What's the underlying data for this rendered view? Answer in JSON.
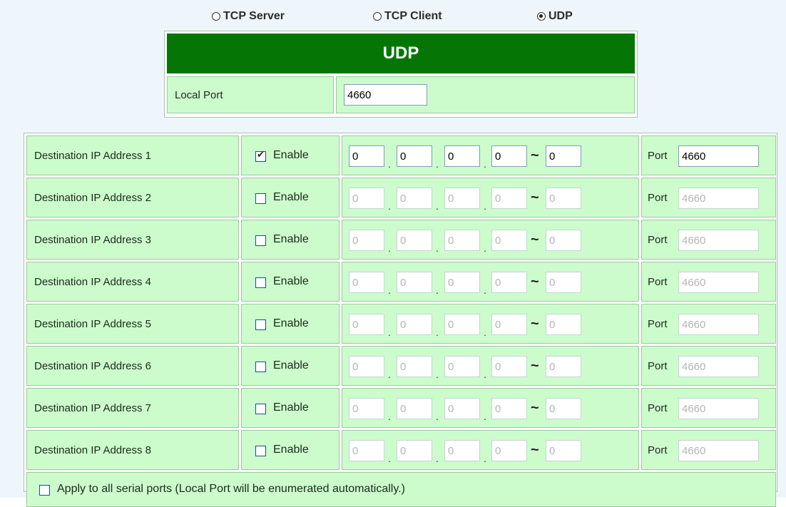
{
  "modes": [
    {
      "label": "TCP Server",
      "selected": false
    },
    {
      "label": "TCP Client",
      "selected": false
    },
    {
      "label": "UDP",
      "selected": true
    }
  ],
  "udp": {
    "title": "UDP",
    "local_port_label": "Local Port",
    "local_port_value": "4660"
  },
  "destinations": [
    {
      "label": "Destination IP Address 1",
      "enabled": true,
      "enable_label": "Enable",
      "ip": [
        "0",
        "0",
        "0",
        "0"
      ],
      "range_end": "0",
      "port_label": "Port",
      "port": "4660"
    },
    {
      "label": "Destination IP Address 2",
      "enabled": false,
      "enable_label": "Enable",
      "ip": [
        "0",
        "0",
        "0",
        "0"
      ],
      "range_end": "0",
      "port_label": "Port",
      "port": "4660"
    },
    {
      "label": "Destination IP Address 3",
      "enabled": false,
      "enable_label": "Enable",
      "ip": [
        "0",
        "0",
        "0",
        "0"
      ],
      "range_end": "0",
      "port_label": "Port",
      "port": "4660"
    },
    {
      "label": "Destination IP Address 4",
      "enabled": false,
      "enable_label": "Enable",
      "ip": [
        "0",
        "0",
        "0",
        "0"
      ],
      "range_end": "0",
      "port_label": "Port",
      "port": "4660"
    },
    {
      "label": "Destination IP Address 5",
      "enabled": false,
      "enable_label": "Enable",
      "ip": [
        "0",
        "0",
        "0",
        "0"
      ],
      "range_end": "0",
      "port_label": "Port",
      "port": "4660"
    },
    {
      "label": "Destination IP Address 6",
      "enabled": false,
      "enable_label": "Enable",
      "ip": [
        "0",
        "0",
        "0",
        "0"
      ],
      "range_end": "0",
      "port_label": "Port",
      "port": "4660"
    },
    {
      "label": "Destination IP Address 7",
      "enabled": false,
      "enable_label": "Enable",
      "ip": [
        "0",
        "0",
        "0",
        "0"
      ],
      "range_end": "0",
      "port_label": "Port",
      "port": "4660"
    },
    {
      "label": "Destination IP Address 8",
      "enabled": false,
      "enable_label": "Enable",
      "ip": [
        "0",
        "0",
        "0",
        "0"
      ],
      "range_end": "0",
      "port_label": "Port",
      "port": "4660"
    }
  ],
  "ip_separator": ".",
  "range_symbol": "~",
  "apply_all": {
    "checked": false,
    "label": "Apply to all serial ports (Local Port will be enumerated automatically.)"
  },
  "colors": {
    "header_green": "#057605",
    "cell_green": "#ccfccc",
    "page_bg": "#eef5fb"
  }
}
